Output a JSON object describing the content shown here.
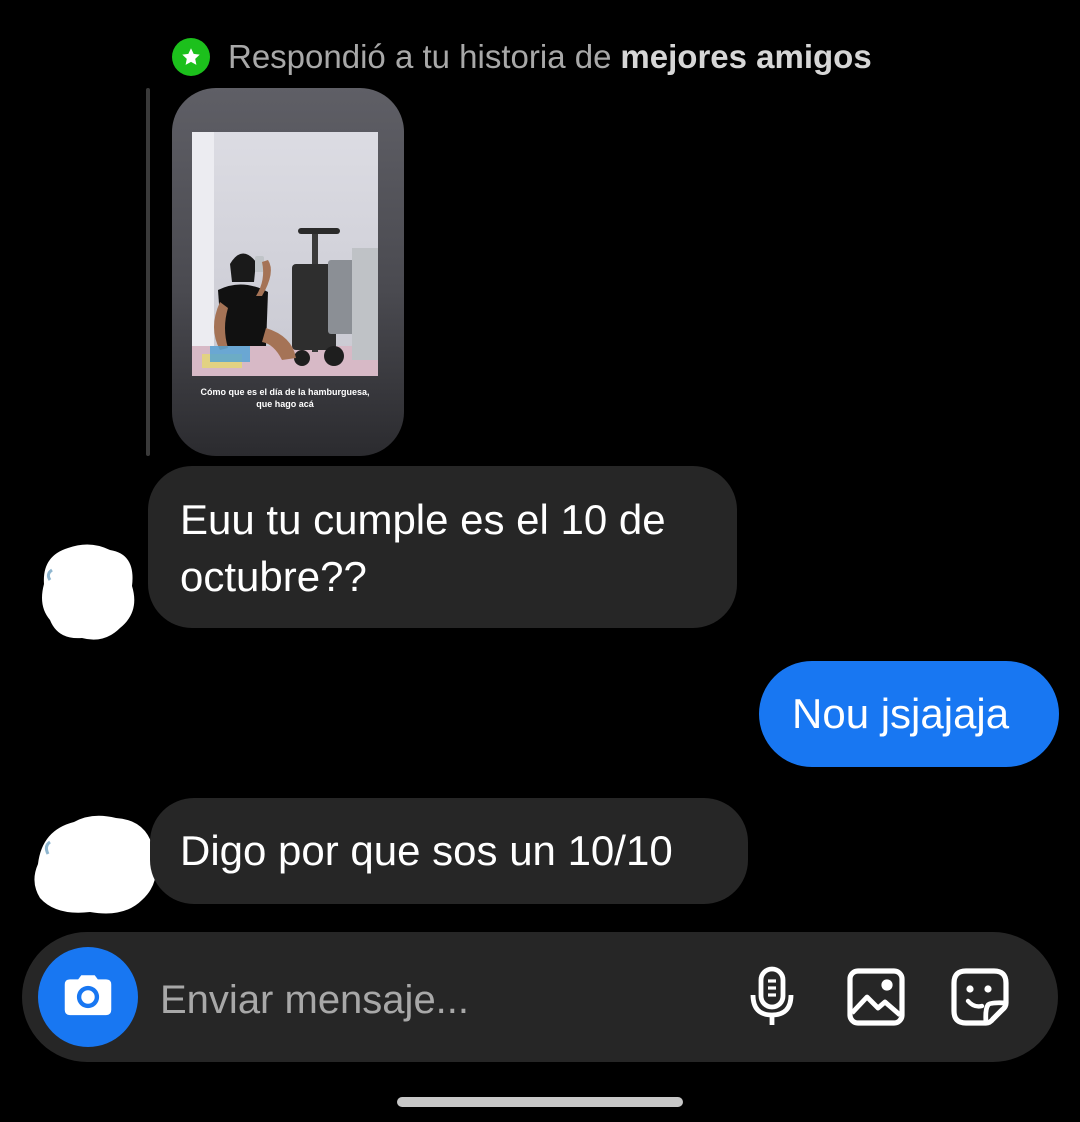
{
  "reply_header": {
    "prefix": "Respondió a tu historia de",
    "bold": "mejores amigos",
    "badge_icon": "star-icon",
    "badge_color": "#1cc01c"
  },
  "story": {
    "caption": "Cómo que es el día de la hamburguesa, que hago acá"
  },
  "messages": [
    {
      "direction": "incoming",
      "text": "Euu tu cumple es el 10 de octubre??"
    },
    {
      "direction": "outgoing",
      "text": "Nou jsjajaja"
    },
    {
      "direction": "incoming",
      "text": "Digo por que sos un 10/10"
    }
  ],
  "composer": {
    "placeholder": "Enviar mensaje...",
    "camera_icon": "camera-icon",
    "mic_icon": "microphone-icon",
    "gallery_icon": "gallery-icon",
    "sticker_icon": "sticker-icon"
  },
  "colors": {
    "background": "#000000",
    "incoming_bubble": "#262626",
    "outgoing_bubble": "#1877f2",
    "accent": "#1877f2"
  }
}
